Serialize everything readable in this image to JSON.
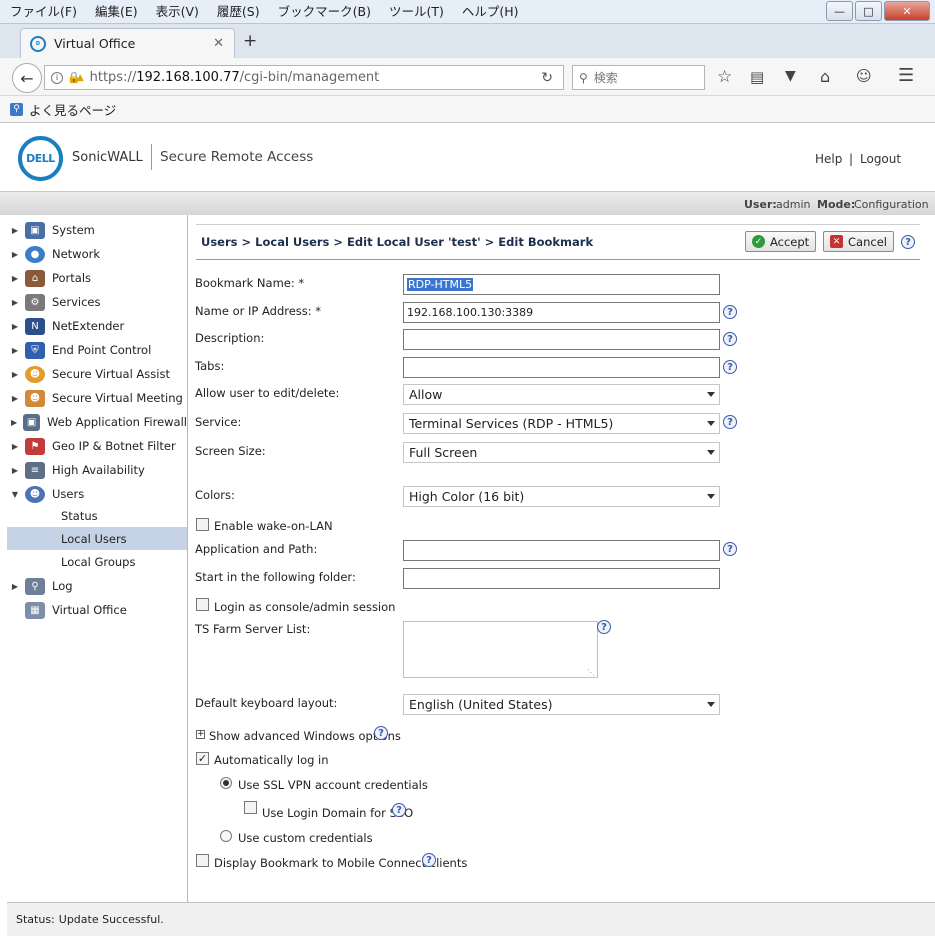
{
  "menubar": {
    "items": [
      "ファイル(F)",
      "編集(E)",
      "表示(V)",
      "履歴(S)",
      "ブックマーク(B)",
      "ツール(T)",
      "ヘルプ(H)"
    ]
  },
  "browser": {
    "tab_title": "Virtual Office",
    "url_scheme": "https://",
    "url_host": "192.168.100.77",
    "url_path": "/cgi-bin/management",
    "search_placeholder": "検索",
    "bookmark_item": "よく見るページ"
  },
  "header": {
    "brand": "SonicWALL",
    "product": "Secure Remote Access",
    "help": "Help",
    "separator": "|",
    "logout": "Logout"
  },
  "userbar": {
    "user_label": "User:",
    "user_value": "admin",
    "mode_label": "Mode:",
    "mode_value": "Configuration"
  },
  "sidebar": {
    "items": [
      {
        "label": "System",
        "icon": "monitor-icon",
        "color": "#4a6fa5"
      },
      {
        "label": "Network",
        "icon": "globe-icon",
        "color": "#3b7ec8"
      },
      {
        "label": "Portals",
        "icon": "house-icon",
        "color": "#8a5a3a"
      },
      {
        "label": "Services",
        "icon": "gears-icon",
        "color": "#7a7a7a"
      },
      {
        "label": "NetExtender",
        "icon": "netextender-icon",
        "color": "#2d4f8c"
      },
      {
        "label": "End Point Control",
        "icon": "shield-icon",
        "color": "#2f5fae"
      },
      {
        "label": "Secure Virtual Assist",
        "icon": "assist-person-icon",
        "color": "#e49b2a"
      },
      {
        "label": "Secure Virtual Meeting",
        "icon": "meeting-people-icon",
        "color": "#d4883a"
      },
      {
        "label": "Web Application Firewall",
        "icon": "firewall-computer-icon",
        "color": "#5a6e8c"
      },
      {
        "label": "Geo IP & Botnet Filter",
        "icon": "geo-flags-icon",
        "color": "#c43b3b"
      },
      {
        "label": "High Availability",
        "icon": "servers-icon",
        "color": "#5d6f86"
      },
      {
        "label": "Users",
        "icon": "users-icon",
        "color": "#4f72b5"
      }
    ],
    "subitems": [
      "Status",
      "Local Users",
      "Local Groups"
    ],
    "after": [
      {
        "label": "Log",
        "icon": "log-magnifier-icon",
        "color": "#6d7f99"
      },
      {
        "label": "Virtual Office",
        "icon": "building-icon",
        "color": "#7d8ea8"
      }
    ]
  },
  "breadcrumb": "Users > Local Users > Edit Local User 'test' > Edit Bookmark",
  "buttons": {
    "accept": "Accept",
    "cancel": "Cancel"
  },
  "form": {
    "bookmark_name_label": "Bookmark Name: *",
    "bookmark_name_value": "RDP-HTML5",
    "host_label": "Name or IP Address: *",
    "host_value": "192.168.100.130:3389",
    "description_label": "Description:",
    "tabs_label": "Tabs:",
    "allow_edit_label": "Allow user to edit/delete:",
    "allow_edit_value": "Allow",
    "service_label": "Service:",
    "service_value": "Terminal Services (RDP - HTML5)",
    "screen_size_label": "Screen Size:",
    "screen_size_value": "Full Screen",
    "colors_label": "Colors:",
    "colors_value": "High Color (16 bit)",
    "wol_label": "Enable wake-on-LAN",
    "app_path_label": "Application and Path:",
    "start_folder_label": "Start in the following folder:",
    "console_label": "Login as console/admin session",
    "ts_farm_label": "TS Farm Server List:",
    "keyboard_label": "Default keyboard layout:",
    "keyboard_value": "English (United States)",
    "advanced_label": "Show advanced Windows options",
    "autologin_label": "Automatically log in",
    "ssl_creds_label": "Use SSL VPN account credentials",
    "login_domain_label": "Use Login Domain for SSO",
    "custom_creds_label": "Use custom credentials",
    "mobile_label": "Display Bookmark to Mobile Connect clients"
  },
  "status": {
    "label": "Status:",
    "value": "Update Successful."
  }
}
